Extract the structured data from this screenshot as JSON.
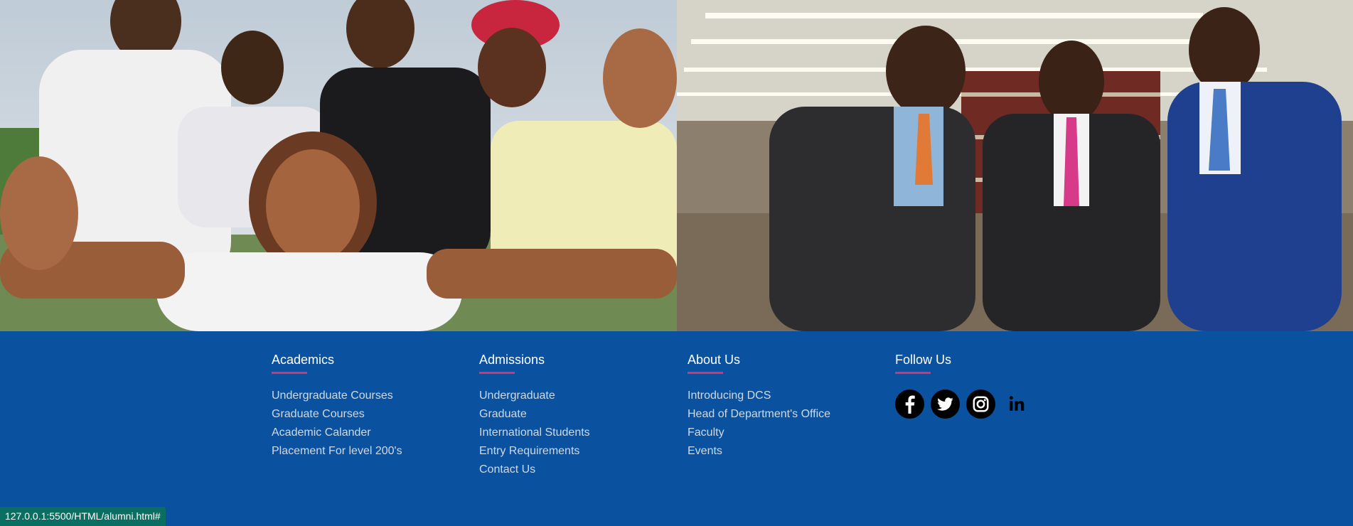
{
  "photos": {
    "students": "students-group-selfie-photo",
    "alumni": "alumni-men-in-suits-library-photo"
  },
  "footer": {
    "academics": {
      "heading": "Academics",
      "links": [
        "Undergraduate Courses",
        "Graduate Courses",
        "Academic Calander",
        "Placement For level 200's"
      ]
    },
    "admissions": {
      "heading": "Admissions",
      "links": [
        "Undergraduate",
        "Graduate",
        "International Students",
        "Entry Requirements",
        "Contact Us"
      ]
    },
    "about": {
      "heading": "About Us",
      "links": [
        "Introducing DCS",
        "Head of Department's Office",
        "Faculty",
        "Events"
      ]
    },
    "follow": {
      "heading": "Follow Us",
      "icons": [
        "facebook-icon",
        "twitter-icon",
        "instagram-icon",
        "linkedin-icon"
      ]
    }
  },
  "status_bar": {
    "url": "127.0.0.1:5500/HTML/alumni.html#"
  },
  "colors": {
    "footer_bg": "#0a52a0",
    "heading_underline": "#d8336b",
    "link_text": "#cfd9e6",
    "status_bg": "#0b6e63"
  }
}
